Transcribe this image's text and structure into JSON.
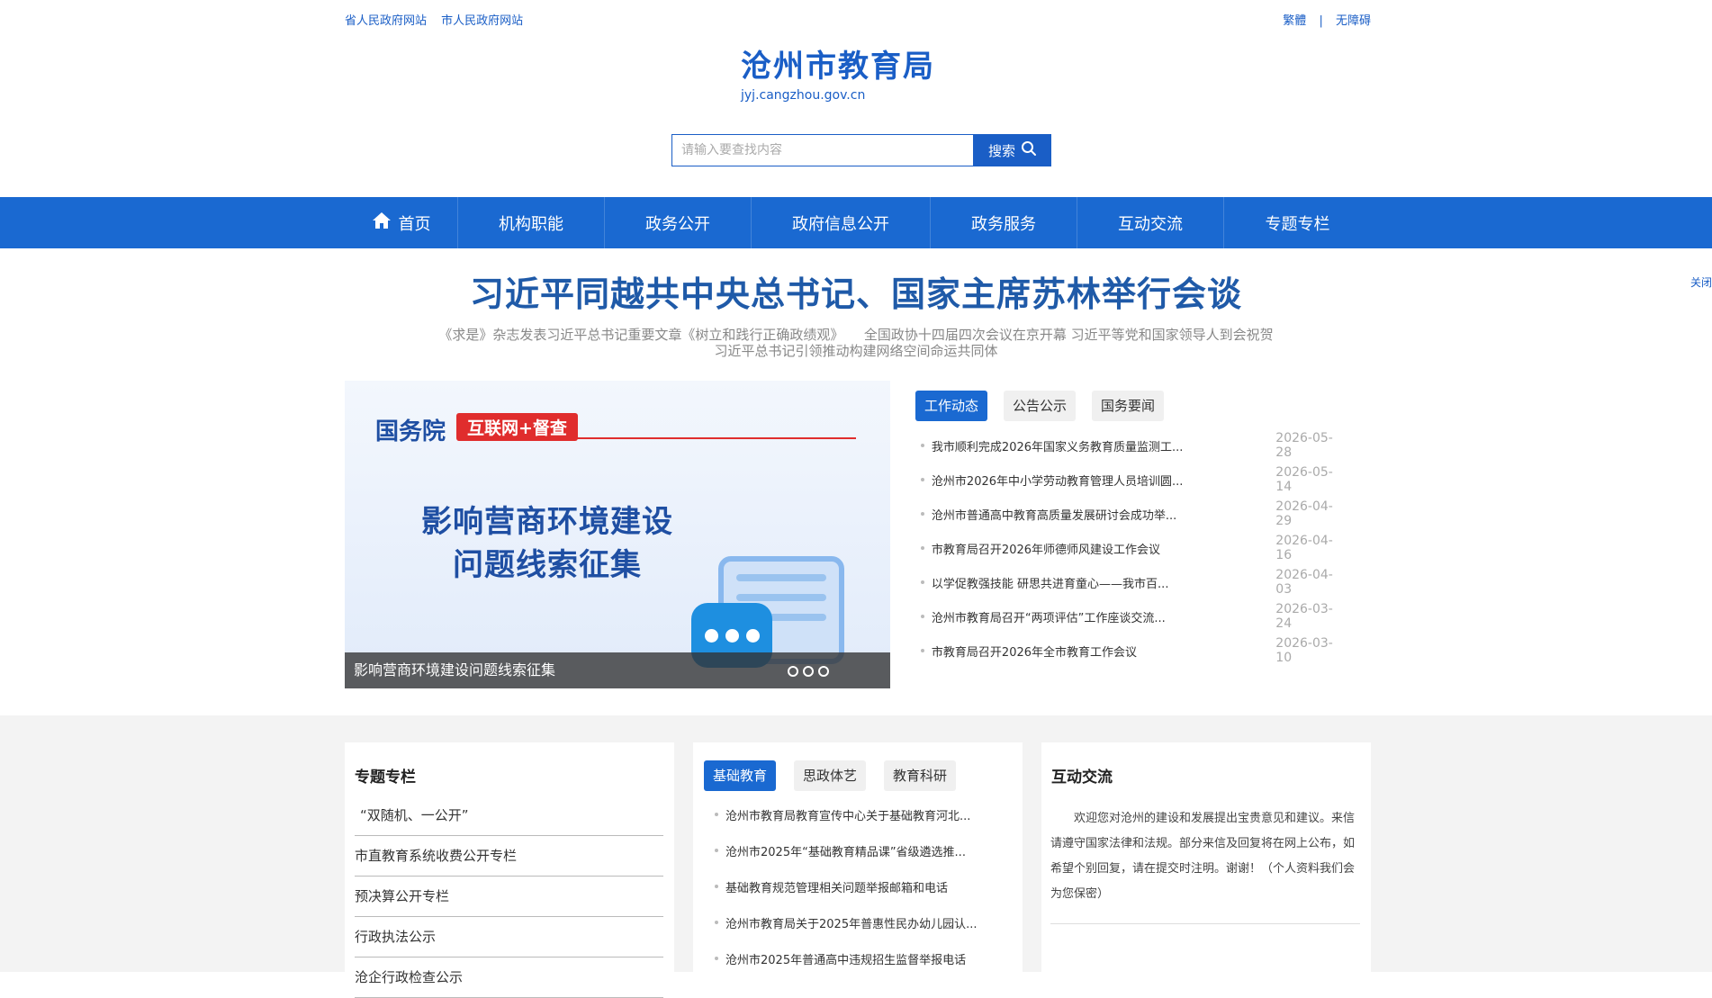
{
  "topbar": {
    "left_links": [
      "省人民政府网站",
      "市人民政府网站"
    ],
    "right_links": [
      "繁體",
      "无障碍"
    ],
    "sep": "|"
  },
  "site": {
    "name": "沧州市教育局",
    "domain": "jyj.cangzhou.gov.cn"
  },
  "search": {
    "placeholder": "请输入要查找内容",
    "button": "搜索"
  },
  "nav": {
    "items": [
      "首页",
      "机构职能",
      "政务公开",
      "政府信息公开",
      "政务服务",
      "互动交流",
      "专题专栏"
    ]
  },
  "headline": {
    "title": "习近平同越共中央总书记、国家主席苏林举行会谈",
    "sub_line1": "《求是》杂志发表习近平总书记重要文章《树立和践行正确政绩观》　　全国政协十四届四次会议在京开幕 习近平等党和国家领导人到会祝贺",
    "sub_line2": "习近平总书记引领推动构建网络空间命运共同体",
    "side": "关闭"
  },
  "banner": {
    "org": "国务院",
    "tag": "互联网+督查",
    "line1": "影响营商环境建设",
    "line2": "问题线索征集",
    "caption": "影响营商环境建设问题线索征集"
  },
  "news": {
    "tabs": [
      "工作动态",
      "公告公示",
      "国务要闻"
    ],
    "items": [
      {
        "title": "我市顺利完成2026年国家义务教育质量监测工...",
        "date": "2026-05-28"
      },
      {
        "title": "沧州市2026年中小学劳动教育管理人员培训圆...",
        "date": "2026-05-14"
      },
      {
        "title": "沧州市普通高中教育高质量发展研讨会成功举...",
        "date": "2026-04-29"
      },
      {
        "title": "市教育局召开2026年师德师风建设工作会议",
        "date": "2026-04-16"
      },
      {
        "title": "以学促教强技能 研思共进育童心——我市百...",
        "date": "2026-04-03"
      },
      {
        "title": "沧州市教育局召开“两项评估”工作座谈交流...",
        "date": "2026-03-24"
      },
      {
        "title": "市教育局召开2026年全市教育工作会议",
        "date": "2026-03-10"
      }
    ]
  },
  "special": {
    "title": "专题专栏",
    "items": [
      "“双随机、一公开”",
      "市直教育系统收费公开专栏",
      "预决算公开专栏",
      "行政执法公示",
      "沧企行政检查公示"
    ]
  },
  "edu": {
    "tabs": [
      "基础教育",
      "思政体艺",
      "教育科研"
    ],
    "items": [
      "沧州市教育局教育宣传中心关于基础教育河北...",
      "沧州市2025年“基础教育精品课”省级遴选推...",
      "基础教育规范管理相关问题举报邮箱和电话",
      "沧州市教育局关于2025年普惠性民办幼儿园认...",
      "沧州市2025年普通高中违规招生监督举报电话"
    ]
  },
  "interact": {
    "title": "互动交流",
    "text": "欢迎您对沧州的建设和发展提出宝贵意见和建议。来信请遵守国家法律和法规。部分来信及回复将在网上公布，如 希望个别回复，请在提交时注明。谢谢！（个人资料我们会为您保密）"
  },
  "colors": {
    "brand": "#1a69d1",
    "headline": "#1f5aa8",
    "alert": "#e02d2d"
  }
}
